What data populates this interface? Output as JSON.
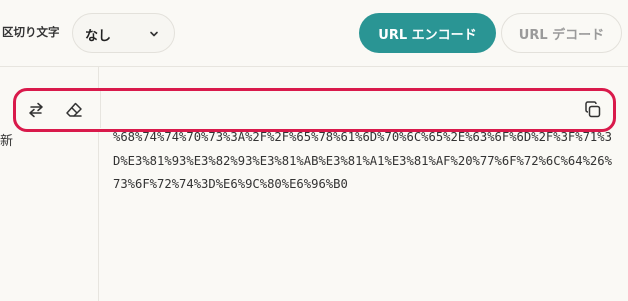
{
  "toolbar": {
    "delimiter_label": "区切り文字",
    "delimiter_value": "なし",
    "encode_label": "URL エンコード",
    "decode_label": "URL デコード"
  },
  "left_pane": {
    "text": "新"
  },
  "actions": {
    "swap_icon": "swap-icon",
    "clear_icon": "eraser-icon",
    "copy_icon": "copy-icon"
  },
  "output": {
    "text": "%68%74%74%70%73%3A%2F%2F%65%78%61%6D%70%6C%65%2E%63%6F%6D%2F%3F%71%3D%E3%81%93%E3%82%93%E3%81%AB%E3%81%A1%E3%81%AF%20%77%6F%72%6C%64%26%73%6F%72%74%3D%E6%9C%80%E6%96%B0"
  },
  "colors": {
    "accent": "#2a9594",
    "highlight": "#d91a4b",
    "background": "#faf9f5"
  }
}
